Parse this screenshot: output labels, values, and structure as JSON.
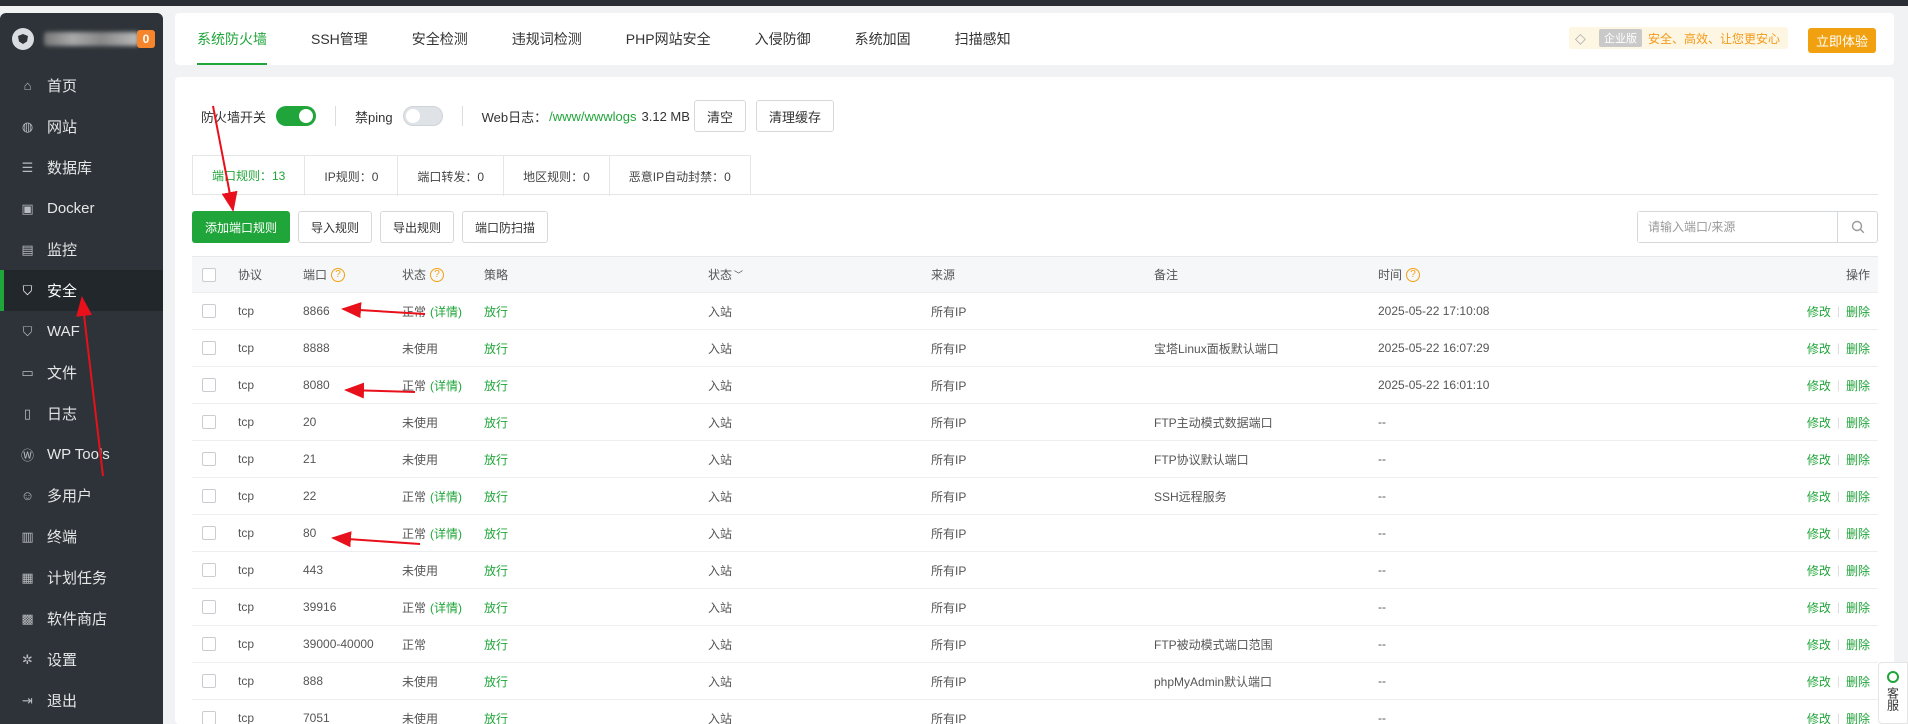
{
  "sidebar": {
    "badge": "0",
    "items": [
      {
        "label": "首页",
        "icon": "home-icon"
      },
      {
        "label": "网站",
        "icon": "globe-icon"
      },
      {
        "label": "数据库",
        "icon": "database-icon"
      },
      {
        "label": "Docker",
        "icon": "docker-icon"
      },
      {
        "label": "监控",
        "icon": "monitor-icon"
      },
      {
        "label": "安全",
        "icon": "shield-icon",
        "active": true
      },
      {
        "label": "WAF",
        "icon": "waf-shield-icon"
      },
      {
        "label": "文件",
        "icon": "folder-icon"
      },
      {
        "label": "日志",
        "icon": "log-icon"
      },
      {
        "label": "WP Tools",
        "icon": "wordpress-icon"
      },
      {
        "label": "多用户",
        "icon": "user-icon"
      },
      {
        "label": "终端",
        "icon": "terminal-icon"
      },
      {
        "label": "计划任务",
        "icon": "calendar-icon"
      },
      {
        "label": "软件商店",
        "icon": "apps-icon"
      },
      {
        "label": "设置",
        "icon": "gear-icon"
      },
      {
        "label": "退出",
        "icon": "logout-icon"
      }
    ]
  },
  "top_tabs": [
    "系统防火墙",
    "SSH管理",
    "安全检测",
    "违规词检测",
    "PHP网站安全",
    "入侵防御",
    "系统加固",
    "扫描感知"
  ],
  "promo": {
    "edition": "企业版",
    "text": "安全、高效、让您更安心",
    "button": "立即体验"
  },
  "firewall": {
    "switch_label": "防火墙开关",
    "switch_on": true,
    "ping_label": "禁ping",
    "ping_on": false,
    "weblog_label": "Web日志：",
    "weblog_path": "/www/wwwlogs",
    "weblog_size": "3.12 MB",
    "clear_button": "清空",
    "clear_cache_button": "清理缓存"
  },
  "rule_tabs": [
    {
      "label": "端口规则：13",
      "active": true
    },
    {
      "label": "IP规则：0"
    },
    {
      "label": "端口转发：0"
    },
    {
      "label": "地区规则：0"
    },
    {
      "label": "恶意IP自动封禁：0"
    }
  ],
  "actions": {
    "add_port_rule": "添加端口规则",
    "import_rules": "导入规则",
    "export_rules": "导出规则",
    "port_scan_protect": "端口防扫描",
    "search_placeholder": "请输入端口/来源"
  },
  "table": {
    "headers": {
      "protocol": "协议",
      "port": "端口",
      "status": "状态",
      "policy": "策略",
      "direction": "状态",
      "source": "来源",
      "remark": "备注",
      "time": "时间",
      "ops": "操作"
    },
    "detail_label": "(详情)",
    "edit_label": "修改",
    "delete_label": "删除",
    "rows": [
      {
        "protocol": "tcp",
        "port": "8866",
        "status": "正常",
        "detail": "(详情)",
        "policy": "放行",
        "direction": "入站",
        "source": "所有IP",
        "remark": "",
        "time": "2025-05-22 17:10:08"
      },
      {
        "protocol": "tcp",
        "port": "8888",
        "status": "未使用",
        "detail": "",
        "policy": "放行",
        "direction": "入站",
        "source": "所有IP",
        "remark": "宝塔Linux面板默认端口",
        "time": "2025-05-22 16:07:29"
      },
      {
        "protocol": "tcp",
        "port": "8080",
        "status": "正常",
        "detail": "(详情)",
        "policy": "放行",
        "direction": "入站",
        "source": "所有IP",
        "remark": "",
        "time": "2025-05-22 16:01:10"
      },
      {
        "protocol": "tcp",
        "port": "20",
        "status": "未使用",
        "detail": "",
        "policy": "放行",
        "direction": "入站",
        "source": "所有IP",
        "remark": "FTP主动模式数据端口",
        "time": "--"
      },
      {
        "protocol": "tcp",
        "port": "21",
        "status": "未使用",
        "detail": "",
        "policy": "放行",
        "direction": "入站",
        "source": "所有IP",
        "remark": "FTP协议默认端口",
        "time": "--"
      },
      {
        "protocol": "tcp",
        "port": "22",
        "status": "正常",
        "detail": "(详情)",
        "policy": "放行",
        "direction": "入站",
        "source": "所有IP",
        "remark": "SSH远程服务",
        "time": "--"
      },
      {
        "protocol": "tcp",
        "port": "80",
        "status": "正常",
        "detail": "(详情)",
        "policy": "放行",
        "direction": "入站",
        "source": "所有IP",
        "remark": "",
        "time": "--"
      },
      {
        "protocol": "tcp",
        "port": "443",
        "status": "未使用",
        "detail": "",
        "policy": "放行",
        "direction": "入站",
        "source": "所有IP",
        "remark": "",
        "time": "--"
      },
      {
        "protocol": "tcp",
        "port": "39916",
        "status": "正常",
        "detail": "(详情)",
        "policy": "放行",
        "direction": "入站",
        "source": "所有IP",
        "remark": "",
        "time": "--"
      },
      {
        "protocol": "tcp",
        "port": "39000-40000",
        "status": "正常",
        "detail": "",
        "policy": "放行",
        "direction": "入站",
        "source": "所有IP",
        "remark": "FTP被动模式端口范围",
        "time": "--"
      },
      {
        "protocol": "tcp",
        "port": "888",
        "status": "未使用",
        "detail": "",
        "policy": "放行",
        "direction": "入站",
        "source": "所有IP",
        "remark": "phpMyAdmin默认端口",
        "time": "--"
      },
      {
        "protocol": "tcp",
        "port": "7051",
        "status": "未使用",
        "detail": "",
        "policy": "放行",
        "direction": "入站",
        "source": "所有IP",
        "remark": "",
        "time": "--"
      }
    ]
  },
  "service_tab": "客服",
  "colors": {
    "accent": "#20a53a",
    "sidebar_bg": "#2d3338",
    "warning": "#f1a00f",
    "annotation": "#e8101a"
  }
}
